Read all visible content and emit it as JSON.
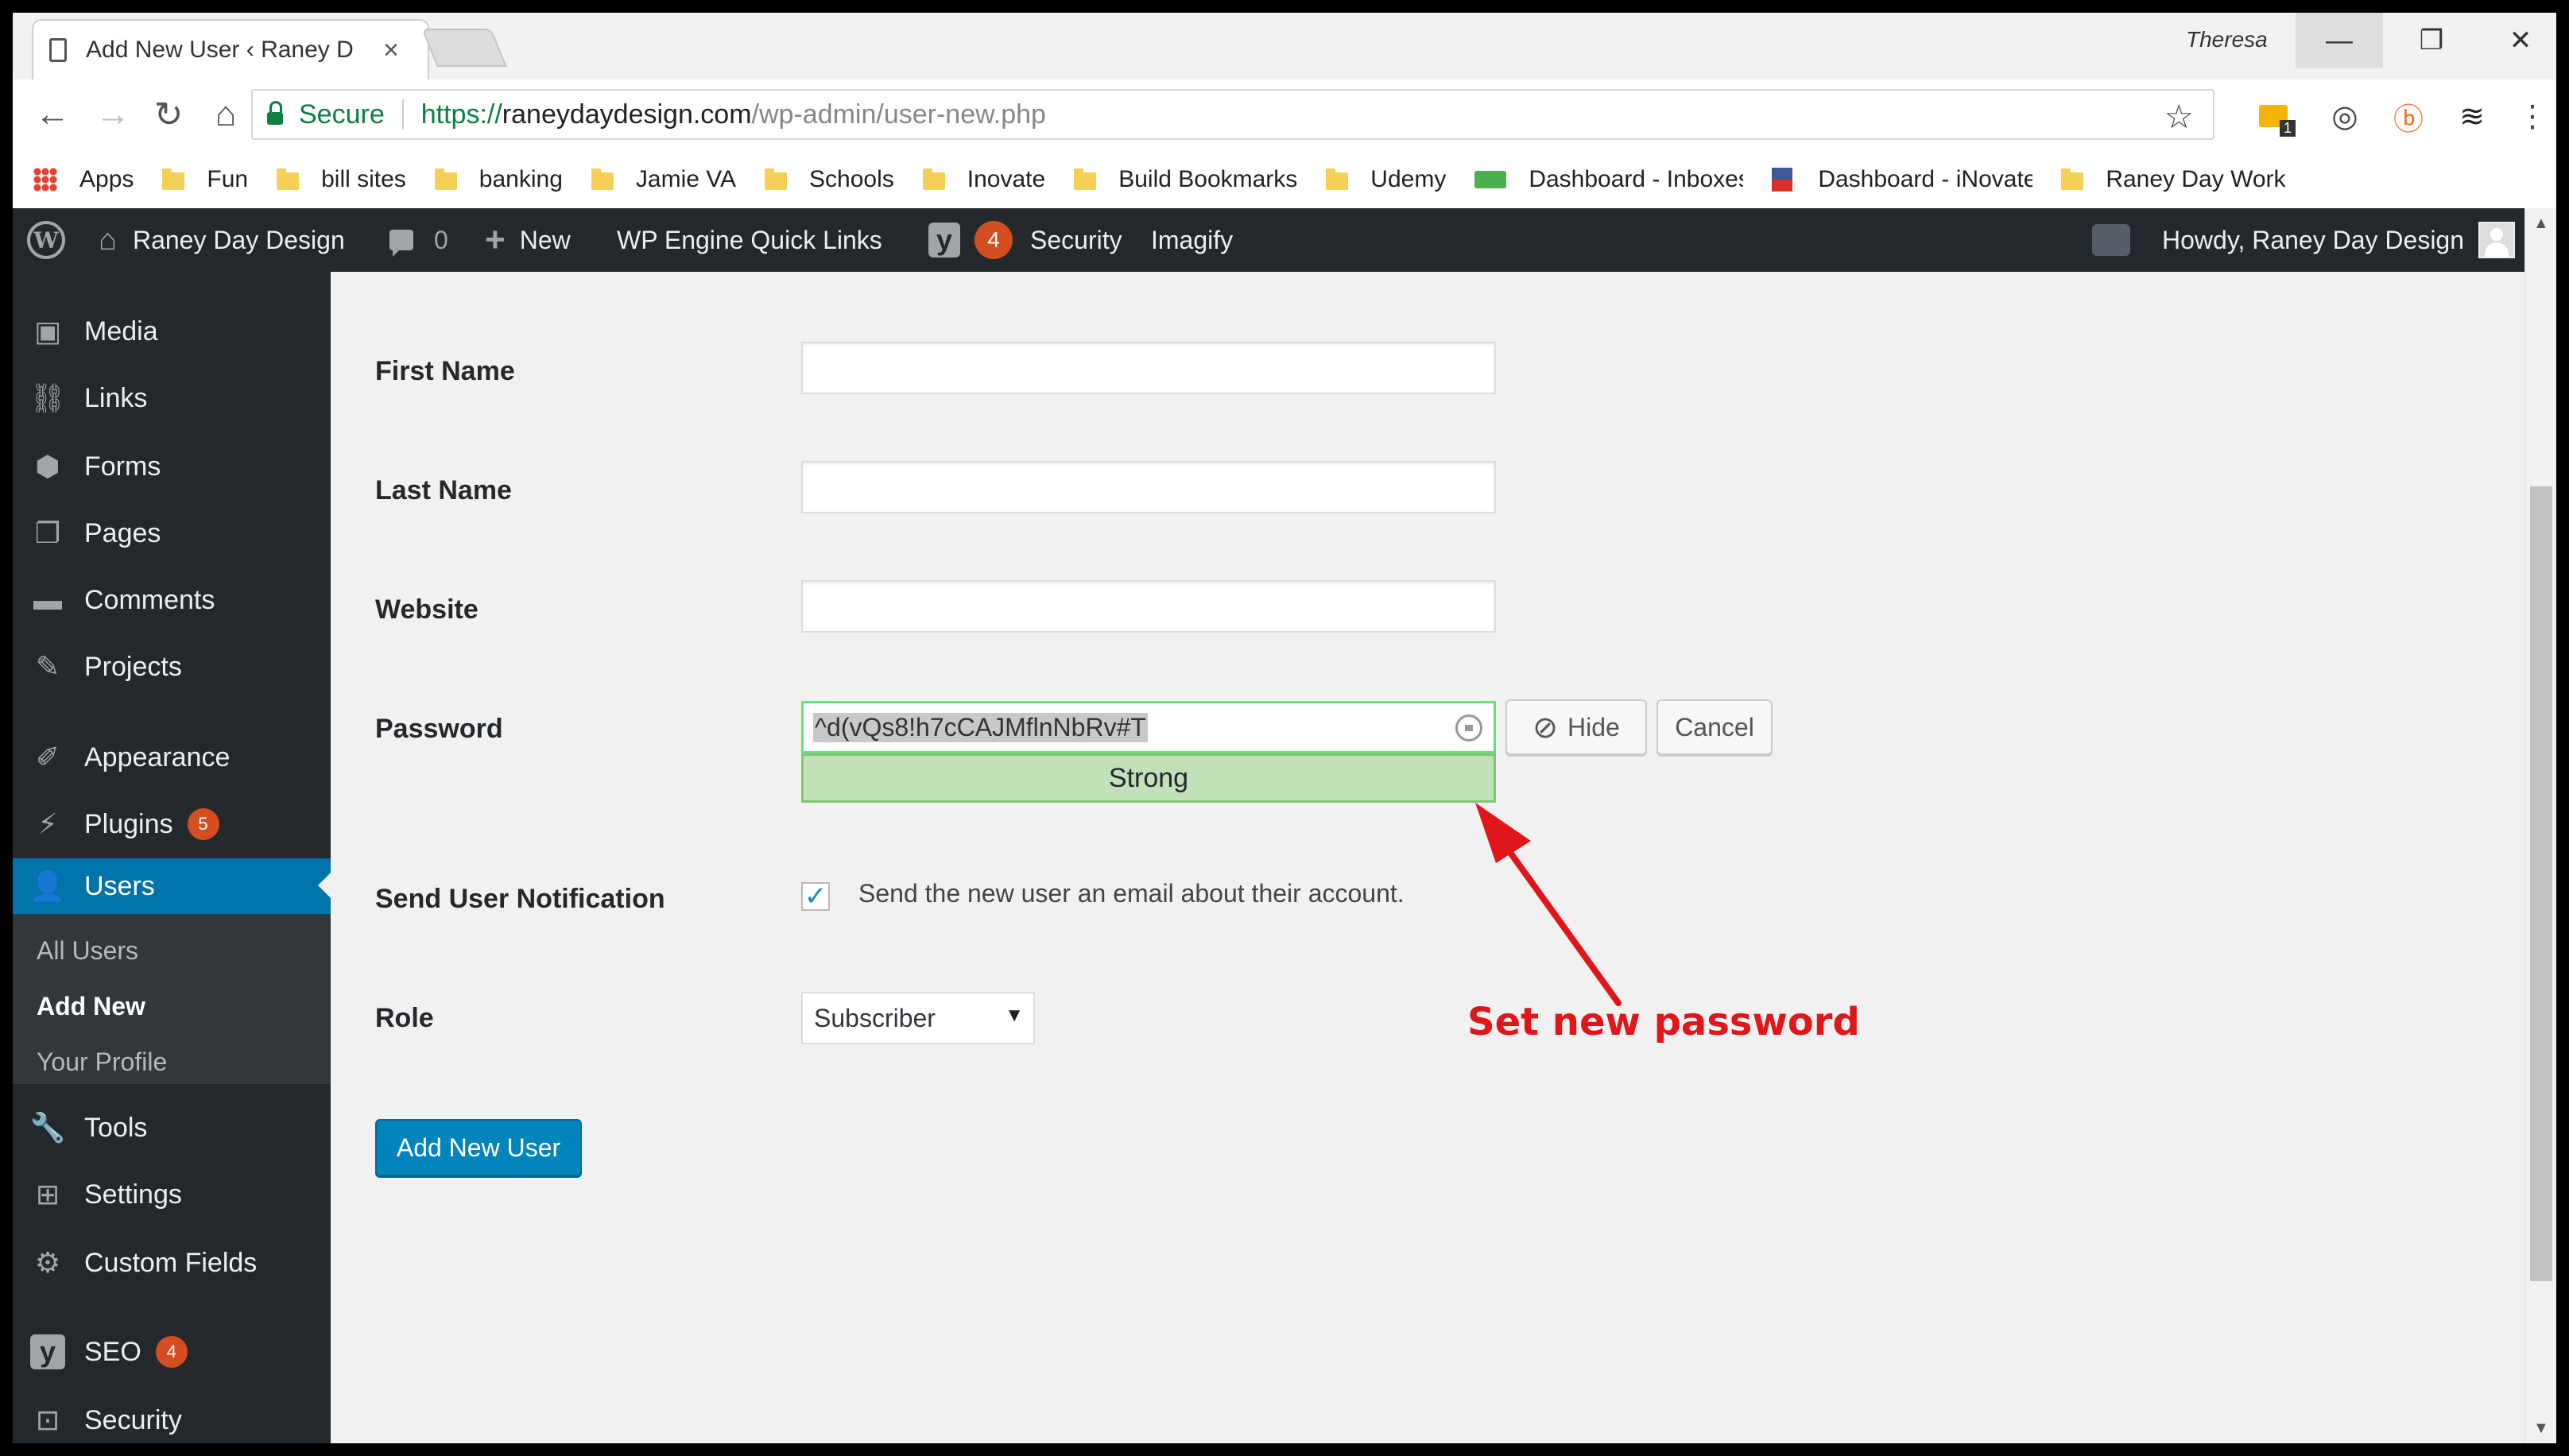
{
  "browser": {
    "tab_title": "Add New User ‹ Raney D",
    "profile_name": "Theresa",
    "secure_label": "Secure",
    "url_scheme": "https://",
    "url_host": "raneydaydesign.com",
    "url_path": "/wp-admin/user-new.php",
    "ext_badge": "1",
    "bookmarks": [
      {
        "label": "Apps",
        "icon": "apps-icon"
      },
      {
        "label": "Fun",
        "icon": "folder-icon"
      },
      {
        "label": "bill sites",
        "icon": "folder-icon"
      },
      {
        "label": "banking",
        "icon": "folder-icon"
      },
      {
        "label": "Jamie VA",
        "icon": "folder-icon"
      },
      {
        "label": "Schools",
        "icon": "folder-icon"
      },
      {
        "label": "Inovate",
        "icon": "folder-icon"
      },
      {
        "label": "Build Bookmarks",
        "icon": "folder-icon"
      },
      {
        "label": "Udemy",
        "icon": "folder-icon"
      },
      {
        "label": "Dashboard - Inboxes",
        "icon": "green-site-icon"
      },
      {
        "label": "Dashboard - iNovate",
        "icon": "flag-site-icon"
      },
      {
        "label": "Raney Day Work",
        "icon": "folder-icon"
      }
    ]
  },
  "adminbar": {
    "site_name": "Raney Day Design",
    "comments_count": "0",
    "new_label": "New",
    "wpengine_label": "WP Engine Quick Links",
    "yoast_badge": "4",
    "security_label": "Security",
    "imagify_label": "Imagify",
    "howdy": "Howdy, Raney Day Design"
  },
  "sidebar": {
    "items": [
      {
        "label": "Media",
        "icon": "media-icon"
      },
      {
        "label": "Links",
        "icon": "links-icon"
      },
      {
        "label": "Forms",
        "icon": "forms-icon"
      },
      {
        "label": "Pages",
        "icon": "pages-icon"
      },
      {
        "label": "Comments",
        "icon": "comments-icon"
      },
      {
        "label": "Projects",
        "icon": "pin-icon"
      },
      {
        "label": "Appearance",
        "icon": "brush-icon"
      },
      {
        "label": "Plugins",
        "icon": "plugin-icon",
        "badge": "5"
      },
      {
        "label": "Users",
        "icon": "users-icon",
        "current": true
      },
      {
        "label": "Tools",
        "icon": "wrench-icon"
      },
      {
        "label": "Settings",
        "icon": "settings-icon"
      },
      {
        "label": "Custom Fields",
        "icon": "gear-icon"
      },
      {
        "label": "SEO",
        "icon": "yoast-icon",
        "badge": "4"
      },
      {
        "label": "Security",
        "icon": "security-icon"
      }
    ],
    "submenu": [
      {
        "label": "All Users"
      },
      {
        "label": "Add New",
        "active": true
      },
      {
        "label": "Your Profile"
      }
    ]
  },
  "form": {
    "first_name_label": "First Name",
    "last_name_label": "Last Name",
    "website_label": "Website",
    "password_label": "Password",
    "password_value": "^d(vQs8!h7cCAJMflnNbRv#T",
    "strength_label": "Strong",
    "hide_label": "Hide",
    "cancel_label": "Cancel",
    "notification_label": "Send User Notification",
    "notification_text": "Send the new user an email about their account.",
    "role_label": "Role",
    "role_value": "Subscriber",
    "submit_label": "Add New User"
  },
  "annotation": {
    "text": "Set new password",
    "color": "#e0161b"
  },
  "colors": {
    "admin_bg": "#23282d",
    "accent": "#0073aa",
    "primary_button": "#0085ba",
    "strength_bg": "#c1e1b9",
    "badge": "#d54e21"
  }
}
